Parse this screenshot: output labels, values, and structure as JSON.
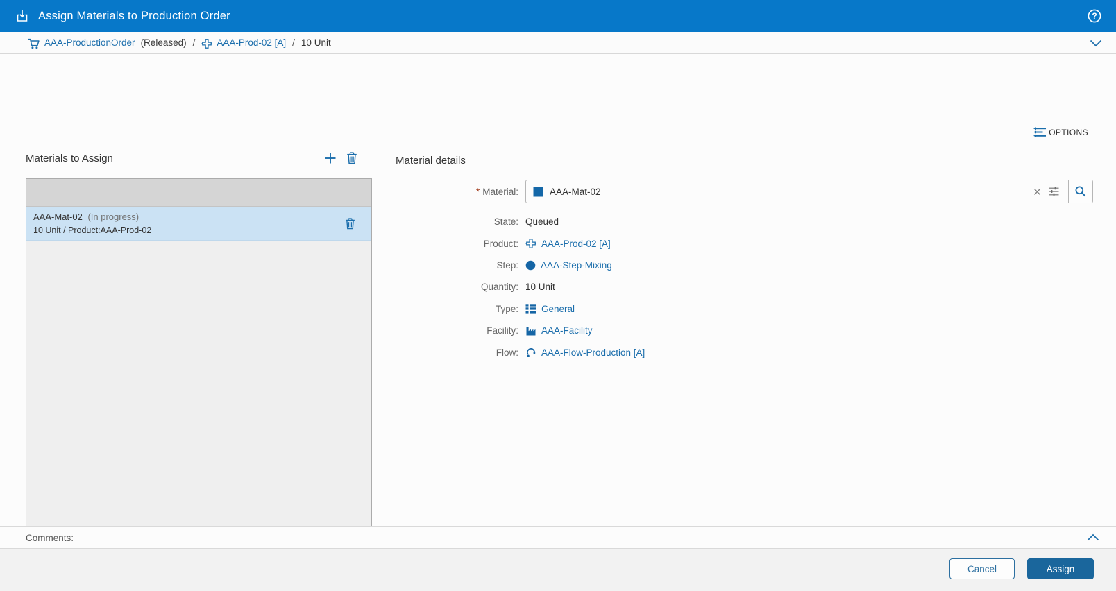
{
  "colors": {
    "accent": "#0778C9",
    "link": "#1B6EAC",
    "icon_blue": "#1565A5",
    "selected_row": "#CBE2F4",
    "list_header": "#D5D5D5",
    "list_bg": "#EFEFEF",
    "border": "#ABABAB",
    "footer_bg": "#F2F2F2",
    "primary_button": "#1A669C",
    "label": "#666666",
    "required": "#A33E1F"
  },
  "titlebar": {
    "title": "Assign Materials to Production Order"
  },
  "breadcrumb": {
    "order_label": "AAA-ProductionOrder",
    "order_state": "(Released)",
    "sep1": "/",
    "product_label": "AAA-Prod-02 [A]",
    "sep2": "/",
    "quantity": "10 Unit"
  },
  "toolbar": {
    "options_label": "OPTIONS"
  },
  "materials_panel": {
    "title": "Materials to Assign",
    "items": [
      {
        "name": "AAA-Mat-02",
        "status": "(In progress)",
        "detail": "10 Unit / Product:AAA-Prod-02"
      }
    ]
  },
  "details_panel": {
    "title": "Material details",
    "material_field": {
      "required_marker": "*",
      "label": "Material:",
      "value": "AAA-Mat-02"
    },
    "fields": [
      {
        "label": "State:",
        "value": "Queued",
        "icon": "",
        "is_link": false
      },
      {
        "label": "Product:",
        "value": "AAA-Prod-02 [A]",
        "icon": "product-icon",
        "is_link": true
      },
      {
        "label": "Step:",
        "value": "AAA-Step-Mixing",
        "icon": "step-icon",
        "is_link": true
      },
      {
        "label": "Quantity:",
        "value": "10 Unit",
        "icon": "",
        "is_link": false
      },
      {
        "label": "Type:",
        "value": "General",
        "icon": "type-icon",
        "is_link": true
      },
      {
        "label": "Facility:",
        "value": "AAA-Facility",
        "icon": "facility-icon",
        "is_link": true
      },
      {
        "label": "Flow:",
        "value": "AAA-Flow-Production [A]",
        "icon": "flow-icon",
        "is_link": true
      }
    ]
  },
  "comments": {
    "label": "Comments:"
  },
  "footer": {
    "cancel_label": "Cancel",
    "assign_label": "Assign"
  }
}
